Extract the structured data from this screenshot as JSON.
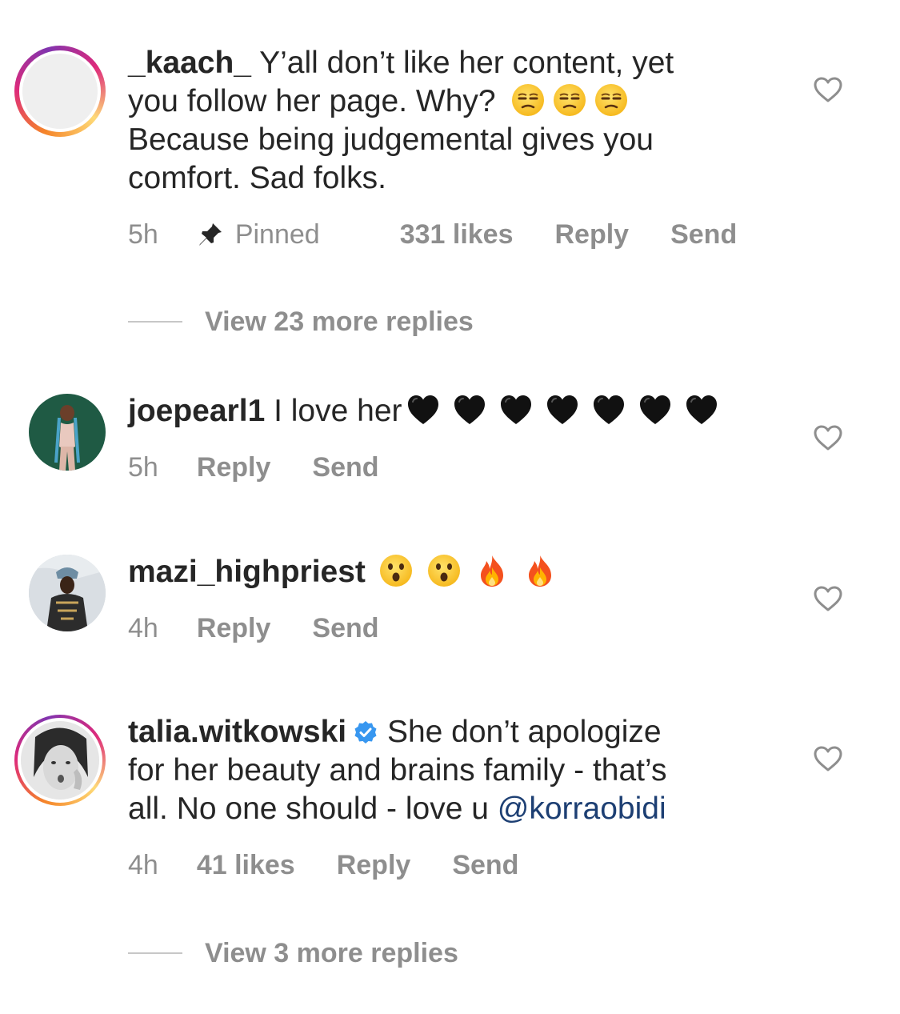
{
  "comments": [
    {
      "username": "_kaach_",
      "text_line1": " Y’all don’t like her content, yet",
      "text_line2": "you follow her page. Why?",
      "text_line3": "Because being judgemental gives you",
      "text_line4": "comfort. Sad folks.",
      "emojis": [
        "unamused-face-emoji",
        "unamused-face-emoji",
        "unamused-face-emoji"
      ],
      "time": "5h",
      "pinned_label": "Pinned",
      "likes": "331 likes",
      "reply": "Reply",
      "send": "Send",
      "view_replies": "View 23 more replies"
    },
    {
      "username": "joepearl1",
      "text": " I love her",
      "emojis": [
        "black-heart-emoji",
        "black-heart-emoji",
        "black-heart-emoji",
        "black-heart-emoji",
        "black-heart-emoji",
        "black-heart-emoji",
        "black-heart-emoji"
      ],
      "time": "5h",
      "reply": "Reply",
      "send": "Send"
    },
    {
      "username": "mazi_highpriest",
      "emojis": [
        "astonished-face-emoji",
        "astonished-face-emoji",
        "fire-emoji",
        "fire-emoji"
      ],
      "time": "4h",
      "reply": "Reply",
      "send": "Send"
    },
    {
      "username": "talia.witkowski",
      "text_line1": " She don’t apologize",
      "text_line2": "for her beauty and brains family - that’s",
      "text_line3": "all. No one should - love u ",
      "mention": "@korraobidi",
      "time": "4h",
      "likes": "41 likes",
      "reply": "Reply",
      "send": "Send",
      "view_replies": "View 3 more replies"
    }
  ],
  "colors": {
    "text": "#262626",
    "meta": "#8e8e8e",
    "mention": "#1d3f73",
    "verified": "#3897f0"
  }
}
